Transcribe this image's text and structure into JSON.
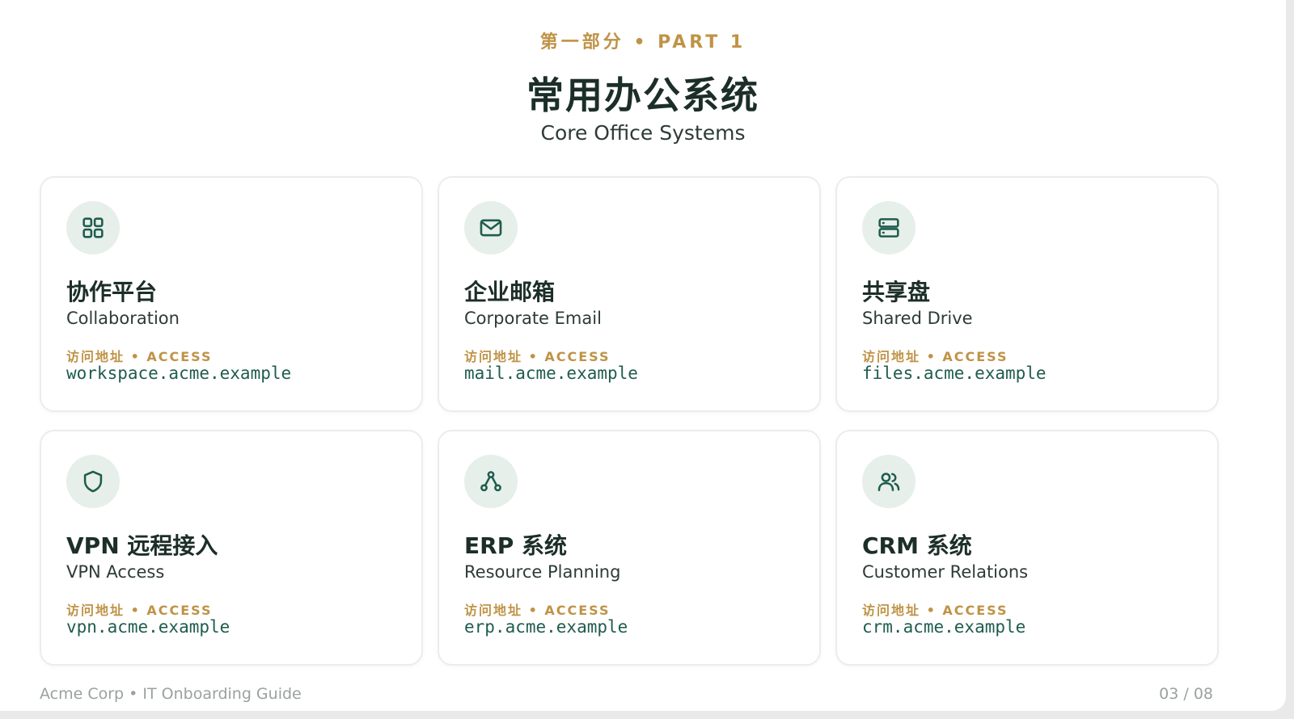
{
  "header": {
    "eyebrow": "第一部分 • PART 1",
    "title": "常用办公系统",
    "subtitle": "Core Office Systems"
  },
  "cards": [
    {
      "icon": "grid-icon",
      "title": "协作平台",
      "subtitle": "Collaboration",
      "access_label": "访问地址 • ACCESS",
      "url": "workspace.acme.example"
    },
    {
      "icon": "mail-icon",
      "title": "企业邮箱",
      "subtitle": "Corporate Email",
      "access_label": "访问地址 • ACCESS",
      "url": "mail.acme.example"
    },
    {
      "icon": "server-icon",
      "title": "共享盘",
      "subtitle": "Shared Drive",
      "access_label": "访问地址 • ACCESS",
      "url": "files.acme.example"
    },
    {
      "icon": "shield-icon",
      "title": "VPN 远程接入",
      "subtitle": "VPN Access",
      "access_label": "访问地址 • ACCESS",
      "url": "vpn.acme.example"
    },
    {
      "icon": "network-icon",
      "title": "ERP 系统",
      "subtitle": "Resource Planning",
      "access_label": "访问地址 • ACCESS",
      "url": "erp.acme.example"
    },
    {
      "icon": "users-icon",
      "title": "CRM 系统",
      "subtitle": "Customer Relations",
      "access_label": "访问地址 • ACCESS",
      "url": "crm.acme.example"
    }
  ],
  "footer": {
    "left": "Acme Corp • IT Onboarding Guide",
    "page": "03 / 08"
  },
  "colors": {
    "accent": "#bf9346",
    "heading": "#1c2e28",
    "url": "#1f5c4d",
    "icon_bg": "#e6efea",
    "icon_stroke": "#1f5c4d"
  }
}
